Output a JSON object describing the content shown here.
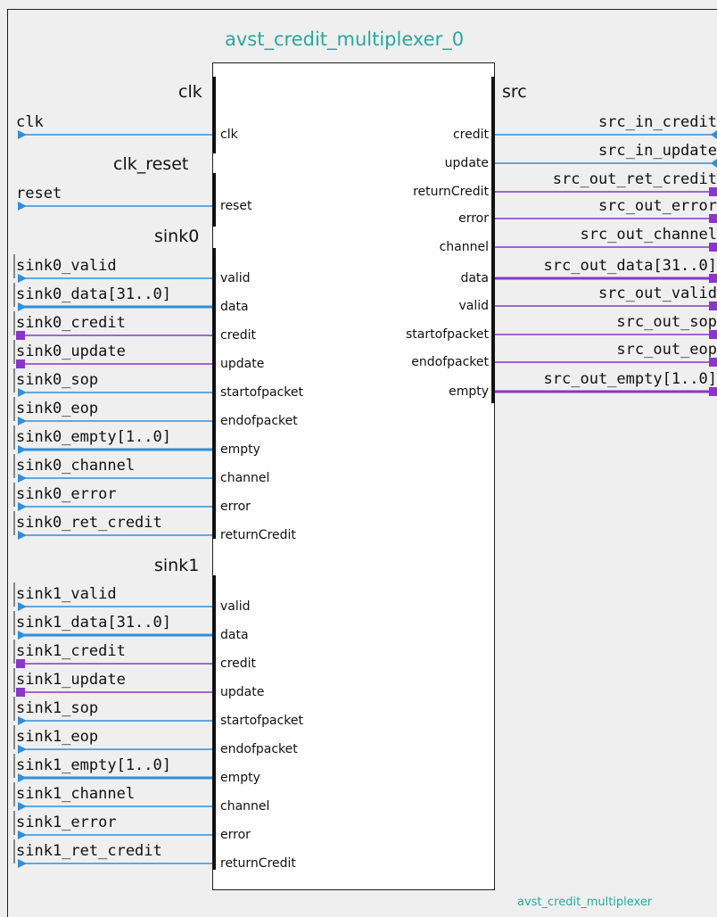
{
  "diagram": {
    "title": "avst_credit_multiplexer_0",
    "footer": "avst_credit_multiplexer",
    "colors": {
      "background": "#efefef",
      "title_text": "#2aa7a0",
      "wire_blue": "#2f8fdc",
      "wire_purple": "#8a36c8",
      "module_fill": "#ffffff",
      "border": "#1e1e1e"
    },
    "interfaces": {
      "clk": "clk",
      "clk_reset": "clk_reset",
      "sink0": "sink0",
      "sink1": "sink1",
      "src": "src"
    },
    "left_rows": [
      {
        "ext": "clk",
        "pin": "clk",
        "color": "blue",
        "bus": false
      },
      {
        "ext": "reset",
        "pin": "reset",
        "color": "blue",
        "bus": false
      },
      {
        "ext": "sink0_valid",
        "pin": "valid",
        "color": "blue",
        "bus": false
      },
      {
        "ext": "sink0_data[31..0]",
        "pin": "data",
        "color": "blue",
        "bus": true
      },
      {
        "ext": "sink0_credit",
        "pin": "credit",
        "color": "purple",
        "bus": false
      },
      {
        "ext": "sink0_update",
        "pin": "update",
        "color": "purple",
        "bus": false
      },
      {
        "ext": "sink0_sop",
        "pin": "startofpacket",
        "color": "blue",
        "bus": false
      },
      {
        "ext": "sink0_eop",
        "pin": "endofpacket",
        "color": "blue",
        "bus": false
      },
      {
        "ext": "sink0_empty[1..0]",
        "pin": "empty",
        "color": "blue",
        "bus": true
      },
      {
        "ext": "sink0_channel",
        "pin": "channel",
        "color": "blue",
        "bus": false
      },
      {
        "ext": "sink0_error",
        "pin": "error",
        "color": "blue",
        "bus": false
      },
      {
        "ext": "sink0_ret_credit",
        "pin": "returnCredit",
        "color": "blue",
        "bus": false
      },
      {
        "ext": "sink1_valid",
        "pin": "valid",
        "color": "blue",
        "bus": false
      },
      {
        "ext": "sink1_data[31..0]",
        "pin": "data",
        "color": "blue",
        "bus": true
      },
      {
        "ext": "sink1_credit",
        "pin": "credit",
        "color": "purple",
        "bus": false
      },
      {
        "ext": "sink1_update",
        "pin": "update",
        "color": "purple",
        "bus": false
      },
      {
        "ext": "sink1_sop",
        "pin": "startofpacket",
        "color": "blue",
        "bus": false
      },
      {
        "ext": "sink1_eop",
        "pin": "endofpacket",
        "color": "blue",
        "bus": false
      },
      {
        "ext": "sink1_empty[1..0]",
        "pin": "empty",
        "color": "blue",
        "bus": true
      },
      {
        "ext": "sink1_channel",
        "pin": "channel",
        "color": "blue",
        "bus": false
      },
      {
        "ext": "sink1_error",
        "pin": "error",
        "color": "blue",
        "bus": false
      },
      {
        "ext": "sink1_ret_credit",
        "pin": "returnCredit",
        "color": "blue",
        "bus": false
      }
    ],
    "right_rows": [
      {
        "ext": "src_in_credit",
        "pin": "credit",
        "color": "blue",
        "bus": false
      },
      {
        "ext": "src_in_update",
        "pin": "update",
        "color": "blue",
        "bus": false
      },
      {
        "ext": "src_out_ret_credit",
        "pin": "returnCredit",
        "color": "purple",
        "bus": false
      },
      {
        "ext": "src_out_error",
        "pin": "error",
        "color": "purple",
        "bus": false
      },
      {
        "ext": "src_out_channel",
        "pin": "channel",
        "color": "purple",
        "bus": false
      },
      {
        "ext": "src_out_data[31..0]",
        "pin": "data",
        "color": "purple",
        "bus": true
      },
      {
        "ext": "src_out_valid",
        "pin": "valid",
        "color": "purple",
        "bus": false
      },
      {
        "ext": "src_out_sop",
        "pin": "startofpacket",
        "color": "purple",
        "bus": false
      },
      {
        "ext": "src_out_eop",
        "pin": "endofpacket",
        "color": "purple",
        "bus": false
      },
      {
        "ext": "src_out_empty[1..0]",
        "pin": "empty",
        "color": "purple",
        "bus": true
      }
    ]
  }
}
